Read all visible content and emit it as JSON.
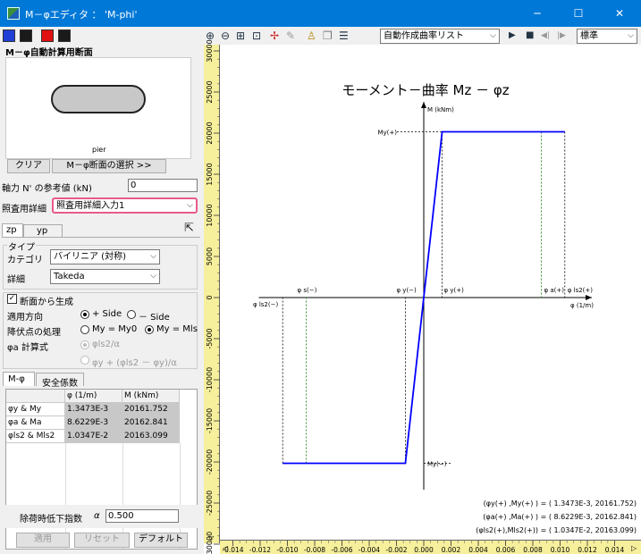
{
  "window": {
    "title": "M－φエディタ ： 'M-phi'",
    "minimize": "─",
    "maximize": "☐",
    "close": "✕"
  },
  "toolbar": {
    "swatches": [
      "#1f3fd6",
      "#1a1a1a",
      "#e01010",
      "#1a1a1a"
    ],
    "icons": [
      "zoom-in",
      "zoom-out",
      "fit",
      "frame",
      "wand",
      "pen",
      "figure",
      "copy",
      "list"
    ],
    "curve_list": "自動作成曲率リスト",
    "play": "▶",
    "stop": "■",
    "prev": "◀|",
    "next": "|▶",
    "style_select": "標準"
  },
  "left": {
    "section_title": "M－φ自動計算用断面",
    "section_name": "pier",
    "clear_btn": "クリア",
    "select_btn": "M－φ断面の選択 >>",
    "axial_label": "軸力 N' の参考値 (kN)",
    "axial_value": "0",
    "detail_label": "照査用詳細",
    "detail_value": "照査用詳細入力1",
    "tabs": [
      "zp",
      "yp"
    ],
    "type_group": "タイプ",
    "category_label": "カテゴリ",
    "category_value": "バイリニア (対称)",
    "detail2_label": "詳細",
    "detail2_value": "Takeda",
    "gen_checkbox": "断面から生成",
    "direction_label": "適用方向",
    "plus_side": "+ Side",
    "minus_side": "－ Side",
    "yield_label": "降伏点の処理",
    "my_my0": "My = My0",
    "my_mls": "My = Mls",
    "phia_label": "φa 計算式",
    "phia_opt1": "φls2/α",
    "phia_opt2": "φy + (φls2 － φy)/α",
    "subtabs": [
      "M-φ",
      "安全係数"
    ],
    "table": {
      "headers": [
        "φ (1/m)",
        "M (kNm)"
      ],
      "rows": [
        {
          "name": "φy & My",
          "phi": "1.3473E-3",
          "m": "20161.752"
        },
        {
          "name": "φa & Ma",
          "phi": "8.6229E-3",
          "m": "20162.841"
        },
        {
          "name": "φls2 & Mls2",
          "phi": "1.0347E-2",
          "m": "20163.099"
        }
      ]
    },
    "unload_label": "除荷時低下指数",
    "alpha": "α",
    "unload_value": "0.500",
    "apply_btn": "適用",
    "reset_btn": "リセット",
    "default_btn": "デフォルト"
  },
  "chart_data": {
    "type": "line",
    "title": "モーメント－曲率 Mz － φz",
    "xlabel": "φ (1/m)",
    "ylabel": "M (kNm)",
    "xlim": [
      -0.014,
      0.014
    ],
    "ylim": [
      -30000,
      30000
    ],
    "x_ticks": [
      "-0.014",
      "-0.012",
      "-0.010",
      "-0.008",
      "-0.006",
      "-0.004",
      "-0.002",
      "0.000",
      "0.002",
      "0.004",
      "0.006",
      "0.008",
      "0.010",
      "0.012",
      "0.014"
    ],
    "y_ticks": [
      "30000",
      "25000",
      "20000",
      "15000",
      "10000",
      "5000",
      "0",
      "-5000",
      "-10000",
      "-15000",
      "-20000",
      "-25000",
      "-30000"
    ],
    "series": [
      {
        "x": [
          -0.010347,
          -0.0013473,
          0,
          0.0013473,
          0.010347
        ],
        "y": [
          -20163.099,
          -20161.752,
          0,
          20161.752,
          20163.099
        ]
      }
    ],
    "markers": {
      "phi_y_pos": 0.0013473,
      "phi_y_neg": -0.0013473,
      "phi_a_pos": 0.0086229,
      "phi_a_neg": -0.0086229,
      "phi_ls2_pos": 0.010347,
      "phi_ls2_neg": -0.010347
    },
    "labels": {
      "my_pos": "My(+)",
      "my_neg": "My(−)",
      "phi_s_neg": "φ s(−)",
      "phi_y_neg": "φ y(−)",
      "phi_y_pos": "φ y(+)",
      "phi_a_pos": "φ a(+)",
      "phi_ls2_pos": "φ ls2(+)",
      "phi_ls2_neg": "φ ls2(−)",
      "xaxis_unit": "φ (1/m)",
      "yaxis_unit": "M (kNm)"
    },
    "readouts": [
      "(φy(+)  ,My(+)  ) = ( 1.3473E-3,  20161.752)",
      "(φa(+)  ,Ma(+)  ) = ( 8.6229E-3,  20162.841)",
      "(φls2(+),Mls2(+)) = ( 1.0347E-2,  20163.099)"
    ],
    "line_color": "#0000ff",
    "marker_color": "#2a8a2a"
  }
}
